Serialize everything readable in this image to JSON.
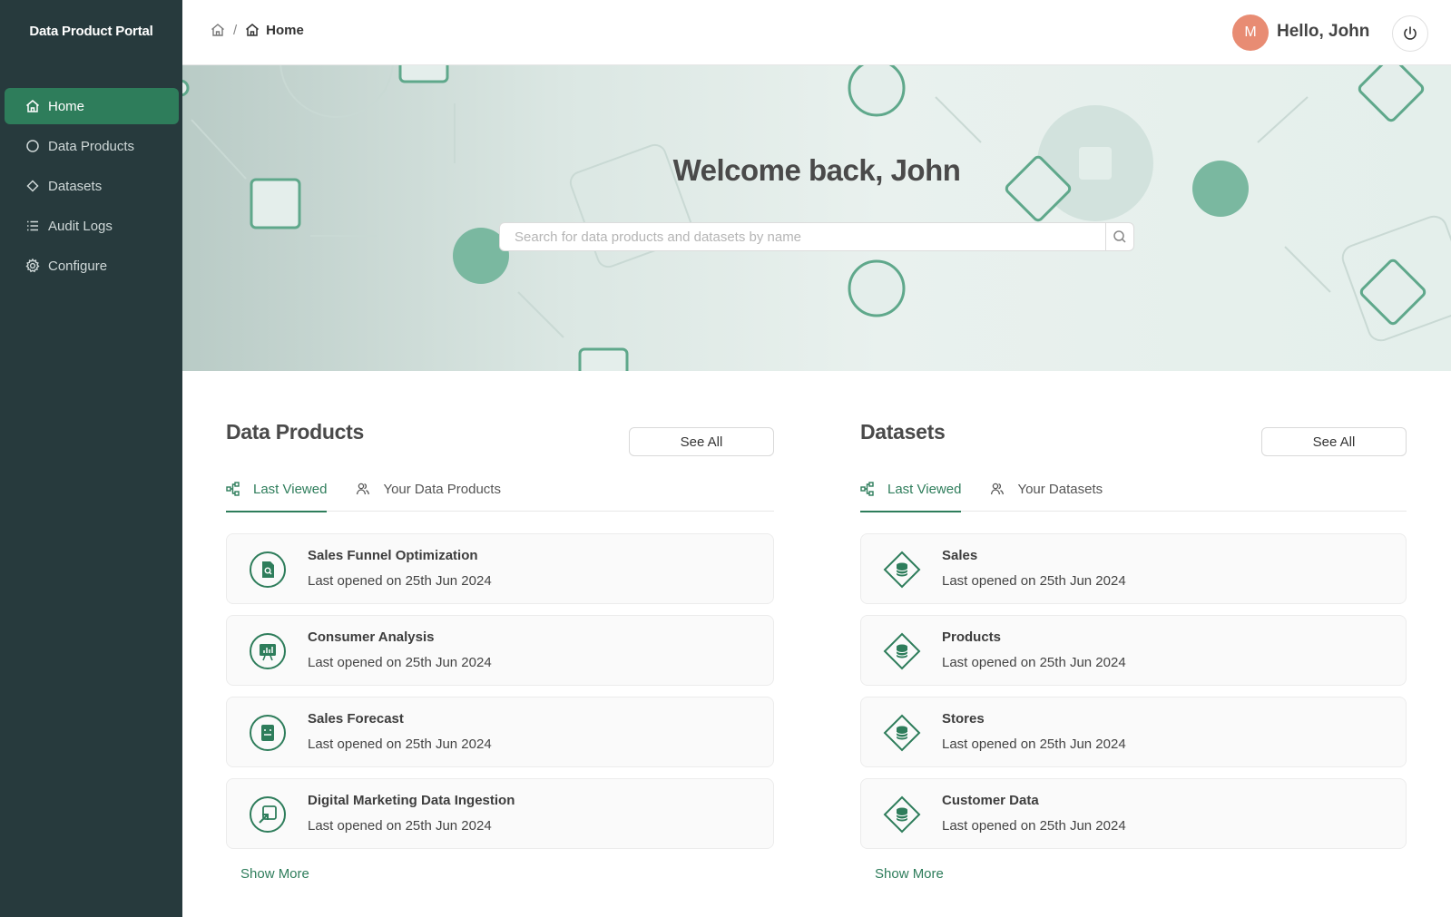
{
  "app": {
    "brand": "Data Product Portal"
  },
  "sidebar": {
    "items": [
      {
        "label": "Home",
        "icon": "home-icon",
        "active": true
      },
      {
        "label": "Data Products",
        "icon": "circle-icon"
      },
      {
        "label": "Datasets",
        "icon": "diamond-icon"
      },
      {
        "label": "Audit Logs",
        "icon": "list-icon"
      },
      {
        "label": "Configure",
        "icon": "gear-icon"
      }
    ]
  },
  "header": {
    "breadcrumb_separator": "/",
    "breadcrumb_current": "Home",
    "avatar_initial": "M",
    "greeting": "Hello, John"
  },
  "hero": {
    "title": "Welcome back, John",
    "search_placeholder": "Search for data products and datasets by name"
  },
  "data_products": {
    "title": "Data Products",
    "see_all": "See All",
    "tabs": [
      {
        "label": "Last Viewed",
        "icon": "lineage-icon",
        "active": true
      },
      {
        "label": "Your Data Products",
        "icon": "users-icon"
      }
    ],
    "items": [
      {
        "name": "Sales Funnel Optimization",
        "sub": "Last opened on 25th Jun 2024",
        "icon": "file-search-icon"
      },
      {
        "name": "Consumer Analysis",
        "sub": "Last opened on 25th Jun 2024",
        "icon": "presentation-chart-icon"
      },
      {
        "name": "Sales Forecast",
        "sub": "Last opened on 25th Jun 2024",
        "icon": "forecast-doc-icon"
      },
      {
        "name": "Digital Marketing Data Ingestion",
        "sub": "Last opened on 25th Jun 2024",
        "icon": "ingest-arrow-icon"
      }
    ],
    "show_more": "Show More"
  },
  "datasets": {
    "title": "Datasets",
    "see_all": "See All",
    "tabs": [
      {
        "label": "Last Viewed",
        "icon": "lineage-icon",
        "active": true
      },
      {
        "label": "Your Datasets",
        "icon": "users-icon"
      }
    ],
    "items": [
      {
        "name": "Sales",
        "sub": "Last opened on 25th Jun 2024",
        "icon": "database-diamond-icon"
      },
      {
        "name": "Products",
        "sub": "Last opened on 25th Jun 2024",
        "icon": "database-diamond-icon"
      },
      {
        "name": "Stores",
        "sub": "Last opened on 25th Jun 2024",
        "icon": "database-diamond-icon"
      },
      {
        "name": "Customer Data",
        "sub": "Last opened on 25th Jun 2024",
        "icon": "database-diamond-icon"
      }
    ],
    "show_more": "Show More"
  },
  "colors": {
    "sidebar_bg": "#273a3d",
    "accent": "#2e7d5b",
    "avatar": "#e88c73"
  }
}
